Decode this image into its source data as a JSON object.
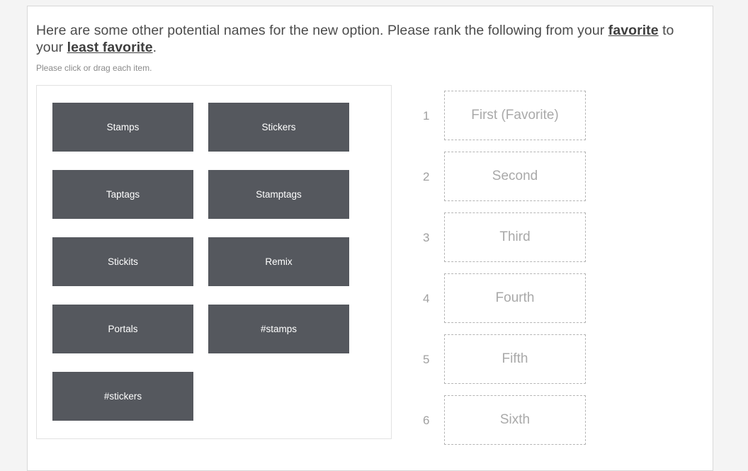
{
  "question": {
    "lead_1": "Here are some other potential names for the new option. Please rank the following from your ",
    "emph_1": "favorite",
    "mid": " to your ",
    "emph_2": "least favorite",
    "tail": ".",
    "instruction": "Please click or drag each item."
  },
  "items": [
    {
      "label": "Stamps"
    },
    {
      "label": "Stickers"
    },
    {
      "label": "Taptags"
    },
    {
      "label": "Stamptags"
    },
    {
      "label": "Stickits"
    },
    {
      "label": "Remix"
    },
    {
      "label": "Portals"
    },
    {
      "label": "#stamps"
    },
    {
      "label": "#stickers"
    }
  ],
  "slots": [
    {
      "number": "1",
      "placeholder": "First (Favorite)"
    },
    {
      "number": "2",
      "placeholder": "Second"
    },
    {
      "number": "3",
      "placeholder": "Third"
    },
    {
      "number": "4",
      "placeholder": "Fourth"
    },
    {
      "number": "5",
      "placeholder": "Fifth"
    },
    {
      "number": "6",
      "placeholder": "Sixth"
    }
  ],
  "colors": {
    "tile_background": "#55585e",
    "tile_text": "#ffffff",
    "slot_border": "#b4b4b4",
    "slot_text": "#a9a9a9",
    "page_background": "#f4f4f4",
    "card_background": "#ffffff"
  }
}
